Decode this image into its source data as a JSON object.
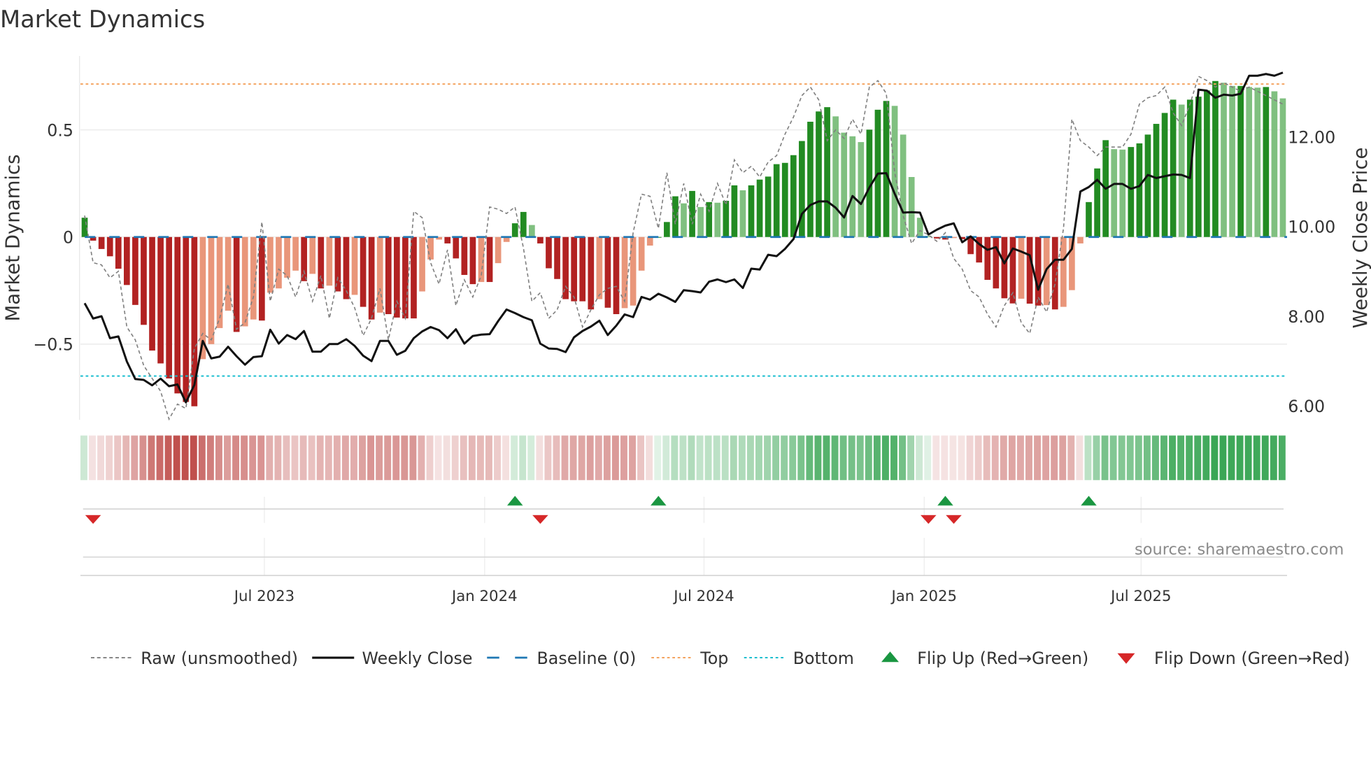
{
  "chart_data": {
    "type": "bar",
    "title": "Market Dynamics",
    "ylabel_left": "Market Dynamics",
    "ylabel_right": "Weekly Close Price",
    "ylim_left": [
      -0.85,
      0.85
    ],
    "ylim_right": [
      5.6,
      13.8
    ],
    "yticks_left": [
      {
        "value": 0.5,
        "label": "0.5"
      },
      {
        "value": 0,
        "label": "0"
      },
      {
        "value": -0.5,
        "label": "−0.5"
      }
    ],
    "yticks_right": [
      {
        "value": 12,
        "label": "12.00"
      },
      {
        "value": 10,
        "label": "10.00"
      },
      {
        "value": 8,
        "label": "8.00"
      },
      {
        "value": 6,
        "label": "6.00"
      }
    ],
    "xticks": [
      {
        "week": 21.3,
        "label": "Jul 2023"
      },
      {
        "week": 47.4,
        "label": "Jan 2024"
      },
      {
        "week": 73.4,
        "label": "Jul 2024"
      },
      {
        "week": 99.5,
        "label": "Jan 2025"
      },
      {
        "week": 125.2,
        "label": "Jul 2025"
      }
    ],
    "top_level": 0.714,
    "bottom_level": -0.649,
    "baseline": 0,
    "smoothed": [
      0.09,
      -0.017,
      -0.056,
      -0.09,
      -0.148,
      -0.224,
      -0.317,
      -0.41,
      -0.53,
      -0.59,
      -0.66,
      -0.73,
      -0.77,
      -0.79,
      -0.57,
      -0.5,
      -0.425,
      -0.344,
      -0.443,
      -0.417,
      -0.385,
      -0.39,
      -0.26,
      -0.24,
      -0.19,
      -0.157,
      -0.206,
      -0.172,
      -0.24,
      -0.227,
      -0.254,
      -0.29,
      -0.27,
      -0.326,
      -0.385,
      -0.353,
      -0.36,
      -0.376,
      -0.38,
      -0.38,
      -0.254,
      -0.105,
      -0.012,
      -0.03,
      -0.1,
      -0.177,
      -0.22,
      -0.21,
      -0.21,
      -0.122,
      -0.023,
      0.064,
      0.117,
      0.056,
      -0.03,
      -0.146,
      -0.196,
      -0.29,
      -0.3,
      -0.3,
      -0.338,
      -0.29,
      -0.33,
      -0.36,
      -0.332,
      -0.32,
      -0.157,
      -0.04,
      0.0,
      0.07,
      0.19,
      0.157,
      0.215,
      0.14,
      0.163,
      0.16,
      0.169,
      0.241,
      0.218,
      0.241,
      0.268,
      0.282,
      0.34,
      0.346,
      0.382,
      0.448,
      0.538,
      0.586,
      0.606,
      0.563,
      0.487,
      0.47,
      0.443,
      0.501,
      0.594,
      0.635,
      0.612,
      0.478,
      0.28,
      0.09,
      0.005,
      -0.007,
      -0.012,
      -0.005,
      -0.01,
      -0.08,
      -0.119,
      -0.2,
      -0.24,
      -0.286,
      -0.31,
      -0.288,
      -0.311,
      -0.32,
      -0.318,
      -0.338,
      -0.326,
      -0.248,
      -0.03,
      0.163,
      0.32,
      0.452,
      0.41,
      0.408,
      0.42,
      0.437,
      0.478,
      0.528,
      0.579,
      0.641,
      0.618,
      0.641,
      0.655,
      0.684,
      0.728,
      0.72,
      0.705,
      0.705,
      0.7,
      0.697,
      0.7,
      0.68,
      0.647
    ],
    "raw": [
      0.1,
      -0.12,
      -0.13,
      -0.19,
      -0.16,
      -0.42,
      -0.48,
      -0.6,
      -0.66,
      -0.72,
      -0.85,
      -0.78,
      -0.8,
      -0.52,
      -0.45,
      -0.48,
      -0.38,
      -0.22,
      -0.43,
      -0.4,
      -0.28,
      0.07,
      -0.3,
      -0.15,
      -0.18,
      -0.28,
      -0.16,
      -0.3,
      -0.18,
      -0.38,
      -0.19,
      -0.25,
      -0.33,
      -0.46,
      -0.38,
      -0.24,
      -0.48,
      -0.3,
      -0.38,
      0.12,
      0.09,
      -0.12,
      -0.22,
      -0.06,
      -0.32,
      -0.2,
      -0.28,
      -0.18,
      0.14,
      0.13,
      0.11,
      0.14,
      -0.05,
      -0.3,
      -0.26,
      -0.38,
      -0.34,
      -0.23,
      -0.28,
      -0.42,
      -0.34,
      -0.27,
      -0.24,
      -0.23,
      -0.3,
      0.02,
      0.2,
      0.19,
      0.04,
      0.3,
      0.06,
      0.25,
      0.06,
      0.2,
      0.12,
      0.25,
      0.15,
      0.36,
      0.3,
      0.33,
      0.28,
      0.35,
      0.38,
      0.48,
      0.56,
      0.66,
      0.7,
      0.64,
      0.45,
      0.5,
      0.46,
      0.55,
      0.48,
      0.7,
      0.73,
      0.67,
      0.3,
      0.1,
      -0.03,
      0.03,
      0.01,
      -0.02,
      0.02,
      -0.1,
      -0.15,
      -0.25,
      -0.28,
      -0.36,
      -0.42,
      -0.32,
      -0.26,
      -0.4,
      -0.45,
      -0.28,
      -0.35,
      -0.22,
      0.04,
      0.55,
      0.45,
      0.42,
      0.38,
      0.42,
      0.42,
      0.42,
      0.48,
      0.62,
      0.65,
      0.66,
      0.7,
      0.58,
      0.52,
      0.62,
      0.75,
      0.73,
      0.7,
      0.72,
      0.7,
      0.68,
      0.7,
      0.68,
      0.66,
      0.64,
      0.62
    ],
    "weekly_close": [
      8.29,
      7.95,
      8.0,
      7.51,
      7.55,
      6.99,
      6.6,
      6.58,
      6.46,
      6.61,
      6.44,
      6.48,
      6.08,
      6.47,
      7.45,
      7.06,
      7.1,
      7.32,
      7.11,
      6.92,
      7.09,
      7.11,
      7.7,
      7.39,
      7.58,
      7.49,
      7.67,
      7.21,
      7.21,
      7.38,
      7.38,
      7.49,
      7.34,
      7.12,
      7.0,
      7.45,
      7.45,
      7.14,
      7.23,
      7.51,
      7.66,
      7.76,
      7.69,
      7.51,
      7.71,
      7.39,
      7.56,
      7.59,
      7.6,
      7.89,
      8.15,
      8.07,
      7.98,
      7.91,
      7.39,
      7.28,
      7.27,
      7.2,
      7.53,
      7.67,
      7.77,
      7.9,
      7.58,
      7.79,
      8.04,
      7.98,
      8.43,
      8.37,
      8.5,
      8.42,
      8.32,
      8.58,
      8.56,
      8.53,
      8.77,
      8.82,
      8.76,
      8.82,
      8.63,
      9.06,
      9.04,
      9.37,
      9.34,
      9.5,
      9.72,
      10.28,
      10.48,
      10.56,
      10.56,
      10.42,
      10.2,
      10.68,
      10.5,
      10.87,
      11.18,
      11.19,
      10.73,
      10.31,
      10.32,
      10.31,
      9.82,
      9.93,
      10.02,
      10.07,
      9.65,
      9.78,
      9.61,
      9.48,
      9.54,
      9.18,
      9.51,
      9.44,
      9.36,
      8.59,
      9.05,
      9.26,
      9.26,
      9.5,
      10.78,
      10.88,
      11.04,
      10.84,
      10.95,
      10.95,
      10.84,
      10.9,
      11.15,
      11.08,
      11.12,
      11.16,
      11.15,
      11.08,
      13.05,
      13.03,
      12.87,
      12.94,
      12.92,
      12.96,
      13.36,
      13.36,
      13.4,
      13.36,
      13.43
    ],
    "flip_up_weeks": [
      51,
      68,
      102,
      119
    ],
    "flip_down_weeks": [
      1,
      54,
      100,
      103
    ],
    "legend": {
      "placement": "bottom",
      "items": [
        {
          "key": "raw",
          "label": "Raw (unsmoothed)"
        },
        {
          "key": "close",
          "label": "Weekly Close"
        },
        {
          "key": "baseline",
          "label": "Baseline (0)"
        },
        {
          "key": "top",
          "label": "Top"
        },
        {
          "key": "bottom",
          "label": "Bottom"
        },
        {
          "key": "flipup",
          "label": "Flip Up (Red→Green)"
        },
        {
          "key": "flipdown",
          "label": "Flip Down (Green→Red)"
        }
      ]
    },
    "source": "source: sharemaestro.com",
    "colors": {
      "pos_rising": "#228b22",
      "pos_falling": "#80c080",
      "neg_falling": "#b22222",
      "neg_rising": "#e9967a",
      "baseline": "#1f77b4",
      "top": "#f4a460",
      "bottom": "#17becf",
      "flip_up": "#1a9641",
      "flip_down": "#d62728",
      "close": "#111111",
      "raw": "#808080"
    }
  }
}
